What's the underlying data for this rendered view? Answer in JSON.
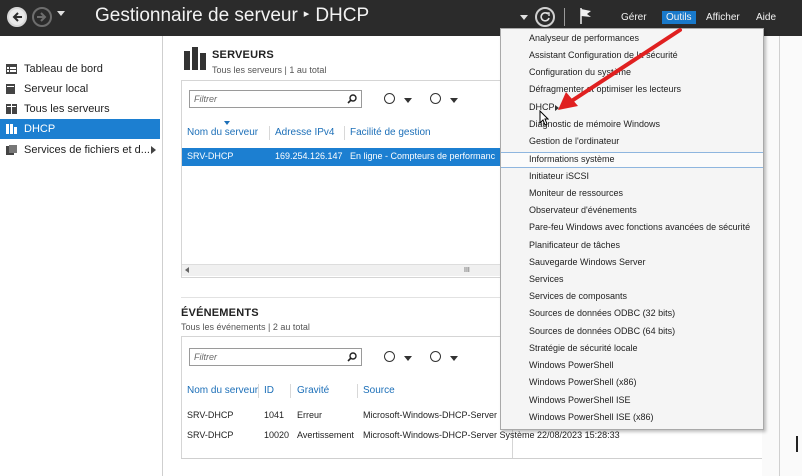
{
  "titlebar": {
    "title": "Gestionnaire de serveur",
    "breadcrumb_sep": "▸",
    "page": "DHCP",
    "menus": [
      "Gérer",
      "Outils",
      "Afficher",
      "Aide"
    ],
    "active_menu_color": "#1979ca"
  },
  "nav": {
    "items": [
      {
        "label": "Tableau de bord",
        "icon": "dashboard-icon"
      },
      {
        "label": "Serveur local",
        "icon": "server-icon"
      },
      {
        "label": "Tous les serveurs",
        "icon": "servers-icon"
      },
      {
        "label": "DHCP",
        "icon": "dhcp-icon",
        "selected": true
      },
      {
        "label": "Services de fichiers et d...",
        "icon": "file-services-icon"
      }
    ],
    "selected_color": "#1c7fd1"
  },
  "servers": {
    "title": "SERVEURS",
    "subtitle": "Tous les serveurs | 1 au total",
    "filter_placeholder": "Filtrer",
    "columns": [
      "Nom du serveur",
      "Adresse IPv4",
      "Facilité de gestion"
    ],
    "rows": [
      [
        "SRV-DHCP",
        "169.254.126.147",
        "En ligne - Compteurs de performanc"
      ]
    ],
    "scroll_thumb": "III"
  },
  "events": {
    "title": "ÉVÉNEMENTS",
    "subtitle": "Tous les événements | 2 au total",
    "filter_placeholder": "Filtrer",
    "columns": [
      "Nom du serveur",
      "ID",
      "Gravité",
      "Source"
    ],
    "rows": [
      [
        "SRV-DHCP",
        "1041",
        "Erreur",
        "Microsoft-Windows-DHCP-Server"
      ],
      [
        "SRV-DHCP",
        "10020",
        "Avertissement",
        "Microsoft-Windows-DHCP-Server Système 22/08/2023 15:28:33"
      ]
    ]
  },
  "tools_menu": {
    "items": [
      "Analyseur de performances",
      "Assistant Configuration de la sécurité",
      "Configuration du système",
      "Défragmenter et optimiser les lecteurs",
      "DHCP",
      "Diagnostic de mémoire Windows",
      "Gestion de l'ordinateur",
      "Informations système",
      "Initiateur iSCSI",
      "Moniteur de ressources",
      "Observateur d'événements",
      "Pare-feu Windows avec fonctions avancées de sécurité",
      "Planificateur de tâches",
      "Sauvegarde Windows Server",
      "Services",
      "Services de composants",
      "Sources de données ODBC (32 bits)",
      "Sources de données ODBC (64 bits)",
      "Stratégie de sécurité locale",
      "Windows PowerShell",
      "Windows PowerShell (x86)",
      "Windows PowerShell ISE",
      "Windows PowerShell ISE (x86)"
    ],
    "highlighted": "Informations système",
    "annotation_arrow_color": "#e02020"
  }
}
